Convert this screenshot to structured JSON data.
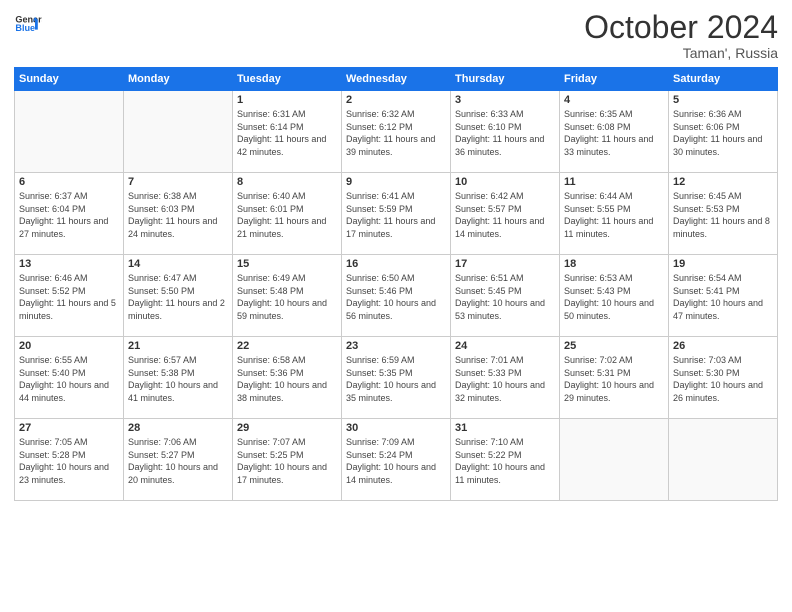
{
  "header": {
    "logo_line1": "General",
    "logo_line2": "Blue",
    "month": "October 2024",
    "location": "Taman', Russia"
  },
  "days_of_week": [
    "Sunday",
    "Monday",
    "Tuesday",
    "Wednesday",
    "Thursday",
    "Friday",
    "Saturday"
  ],
  "weeks": [
    [
      {
        "day": "",
        "info": ""
      },
      {
        "day": "",
        "info": ""
      },
      {
        "day": "1",
        "info": "Sunrise: 6:31 AM\nSunset: 6:14 PM\nDaylight: 11 hours and 42 minutes."
      },
      {
        "day": "2",
        "info": "Sunrise: 6:32 AM\nSunset: 6:12 PM\nDaylight: 11 hours and 39 minutes."
      },
      {
        "day": "3",
        "info": "Sunrise: 6:33 AM\nSunset: 6:10 PM\nDaylight: 11 hours and 36 minutes."
      },
      {
        "day": "4",
        "info": "Sunrise: 6:35 AM\nSunset: 6:08 PM\nDaylight: 11 hours and 33 minutes."
      },
      {
        "day": "5",
        "info": "Sunrise: 6:36 AM\nSunset: 6:06 PM\nDaylight: 11 hours and 30 minutes."
      }
    ],
    [
      {
        "day": "6",
        "info": "Sunrise: 6:37 AM\nSunset: 6:04 PM\nDaylight: 11 hours and 27 minutes."
      },
      {
        "day": "7",
        "info": "Sunrise: 6:38 AM\nSunset: 6:03 PM\nDaylight: 11 hours and 24 minutes."
      },
      {
        "day": "8",
        "info": "Sunrise: 6:40 AM\nSunset: 6:01 PM\nDaylight: 11 hours and 21 minutes."
      },
      {
        "day": "9",
        "info": "Sunrise: 6:41 AM\nSunset: 5:59 PM\nDaylight: 11 hours and 17 minutes."
      },
      {
        "day": "10",
        "info": "Sunrise: 6:42 AM\nSunset: 5:57 PM\nDaylight: 11 hours and 14 minutes."
      },
      {
        "day": "11",
        "info": "Sunrise: 6:44 AM\nSunset: 5:55 PM\nDaylight: 11 hours and 11 minutes."
      },
      {
        "day": "12",
        "info": "Sunrise: 6:45 AM\nSunset: 5:53 PM\nDaylight: 11 hours and 8 minutes."
      }
    ],
    [
      {
        "day": "13",
        "info": "Sunrise: 6:46 AM\nSunset: 5:52 PM\nDaylight: 11 hours and 5 minutes."
      },
      {
        "day": "14",
        "info": "Sunrise: 6:47 AM\nSunset: 5:50 PM\nDaylight: 11 hours and 2 minutes."
      },
      {
        "day": "15",
        "info": "Sunrise: 6:49 AM\nSunset: 5:48 PM\nDaylight: 10 hours and 59 minutes."
      },
      {
        "day": "16",
        "info": "Sunrise: 6:50 AM\nSunset: 5:46 PM\nDaylight: 10 hours and 56 minutes."
      },
      {
        "day": "17",
        "info": "Sunrise: 6:51 AM\nSunset: 5:45 PM\nDaylight: 10 hours and 53 minutes."
      },
      {
        "day": "18",
        "info": "Sunrise: 6:53 AM\nSunset: 5:43 PM\nDaylight: 10 hours and 50 minutes."
      },
      {
        "day": "19",
        "info": "Sunrise: 6:54 AM\nSunset: 5:41 PM\nDaylight: 10 hours and 47 minutes."
      }
    ],
    [
      {
        "day": "20",
        "info": "Sunrise: 6:55 AM\nSunset: 5:40 PM\nDaylight: 10 hours and 44 minutes."
      },
      {
        "day": "21",
        "info": "Sunrise: 6:57 AM\nSunset: 5:38 PM\nDaylight: 10 hours and 41 minutes."
      },
      {
        "day": "22",
        "info": "Sunrise: 6:58 AM\nSunset: 5:36 PM\nDaylight: 10 hours and 38 minutes."
      },
      {
        "day": "23",
        "info": "Sunrise: 6:59 AM\nSunset: 5:35 PM\nDaylight: 10 hours and 35 minutes."
      },
      {
        "day": "24",
        "info": "Sunrise: 7:01 AM\nSunset: 5:33 PM\nDaylight: 10 hours and 32 minutes."
      },
      {
        "day": "25",
        "info": "Sunrise: 7:02 AM\nSunset: 5:31 PM\nDaylight: 10 hours and 29 minutes."
      },
      {
        "day": "26",
        "info": "Sunrise: 7:03 AM\nSunset: 5:30 PM\nDaylight: 10 hours and 26 minutes."
      }
    ],
    [
      {
        "day": "27",
        "info": "Sunrise: 7:05 AM\nSunset: 5:28 PM\nDaylight: 10 hours and 23 minutes."
      },
      {
        "day": "28",
        "info": "Sunrise: 7:06 AM\nSunset: 5:27 PM\nDaylight: 10 hours and 20 minutes."
      },
      {
        "day": "29",
        "info": "Sunrise: 7:07 AM\nSunset: 5:25 PM\nDaylight: 10 hours and 17 minutes."
      },
      {
        "day": "30",
        "info": "Sunrise: 7:09 AM\nSunset: 5:24 PM\nDaylight: 10 hours and 14 minutes."
      },
      {
        "day": "31",
        "info": "Sunrise: 7:10 AM\nSunset: 5:22 PM\nDaylight: 10 hours and 11 minutes."
      },
      {
        "day": "",
        "info": ""
      },
      {
        "day": "",
        "info": ""
      }
    ]
  ]
}
